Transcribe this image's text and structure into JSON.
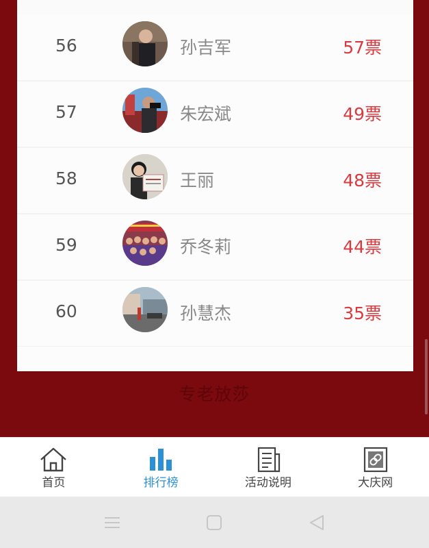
{
  "ranking": [
    {
      "rank": "56",
      "name": "孙吉军",
      "votes": "57票",
      "avatar": "person-in-black-avatar"
    },
    {
      "rank": "57",
      "name": "朱宏斌",
      "votes": "49票",
      "avatar": "outdoor-photographer-avatar"
    },
    {
      "rank": "58",
      "name": "王丽",
      "votes": "48票",
      "avatar": "woman-holding-certificate-avatar"
    },
    {
      "rank": "59",
      "name": "乔冬莉",
      "votes": "44票",
      "avatar": "group-photo-avatar"
    },
    {
      "rank": "60",
      "name": "孙慧杰",
      "votes": "35票",
      "avatar": "street-scene-avatar"
    }
  ],
  "footer": {
    "link_text": "专老放莎"
  },
  "tabbar": {
    "tabs": [
      {
        "label": "首页",
        "icon": "home-icon",
        "active": false
      },
      {
        "label": "排行榜",
        "icon": "bar-chart-icon",
        "active": true
      },
      {
        "label": "活动说明",
        "icon": "document-icon",
        "active": false
      },
      {
        "label": "大庆网",
        "icon": "link-icon",
        "active": false
      }
    ]
  },
  "navbar": {
    "buttons": [
      "menu-icon",
      "home-square-icon",
      "back-triangle-icon"
    ]
  },
  "colors": {
    "background": "#7a0a0e",
    "votes": "#d73a3f",
    "active_tab": "#2a91d6"
  }
}
